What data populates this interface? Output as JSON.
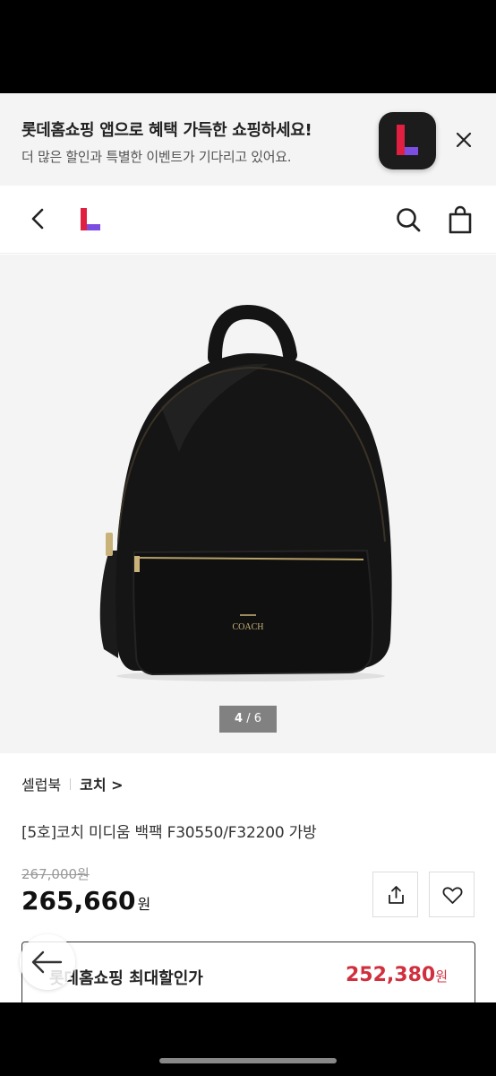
{
  "banner": {
    "title": "롯데홈쇼핑 앱으로 혜택 가득한 쇼핑하세요!",
    "subtitle": "더 많은 할인과 특별한 이벤트가 기다리고 있어요."
  },
  "gallery": {
    "current": "4",
    "separator": "/",
    "total": "6",
    "logo_text": "COACH"
  },
  "product": {
    "seller": "셀럽북",
    "brand": "코치 >",
    "title": "[5호]코치 미디움 백팩 F30550/F32200 가방",
    "original_price": "267,000원",
    "price": "265,660",
    "price_unit": "원"
  },
  "max_discount": {
    "label": "롯데홈쇼핑 최대할인가",
    "price": "252,380",
    "unit": "원"
  },
  "colors": {
    "accent_red": "#d0303e",
    "logo_red": "#e02040",
    "logo_purple": "#7b4de0"
  }
}
